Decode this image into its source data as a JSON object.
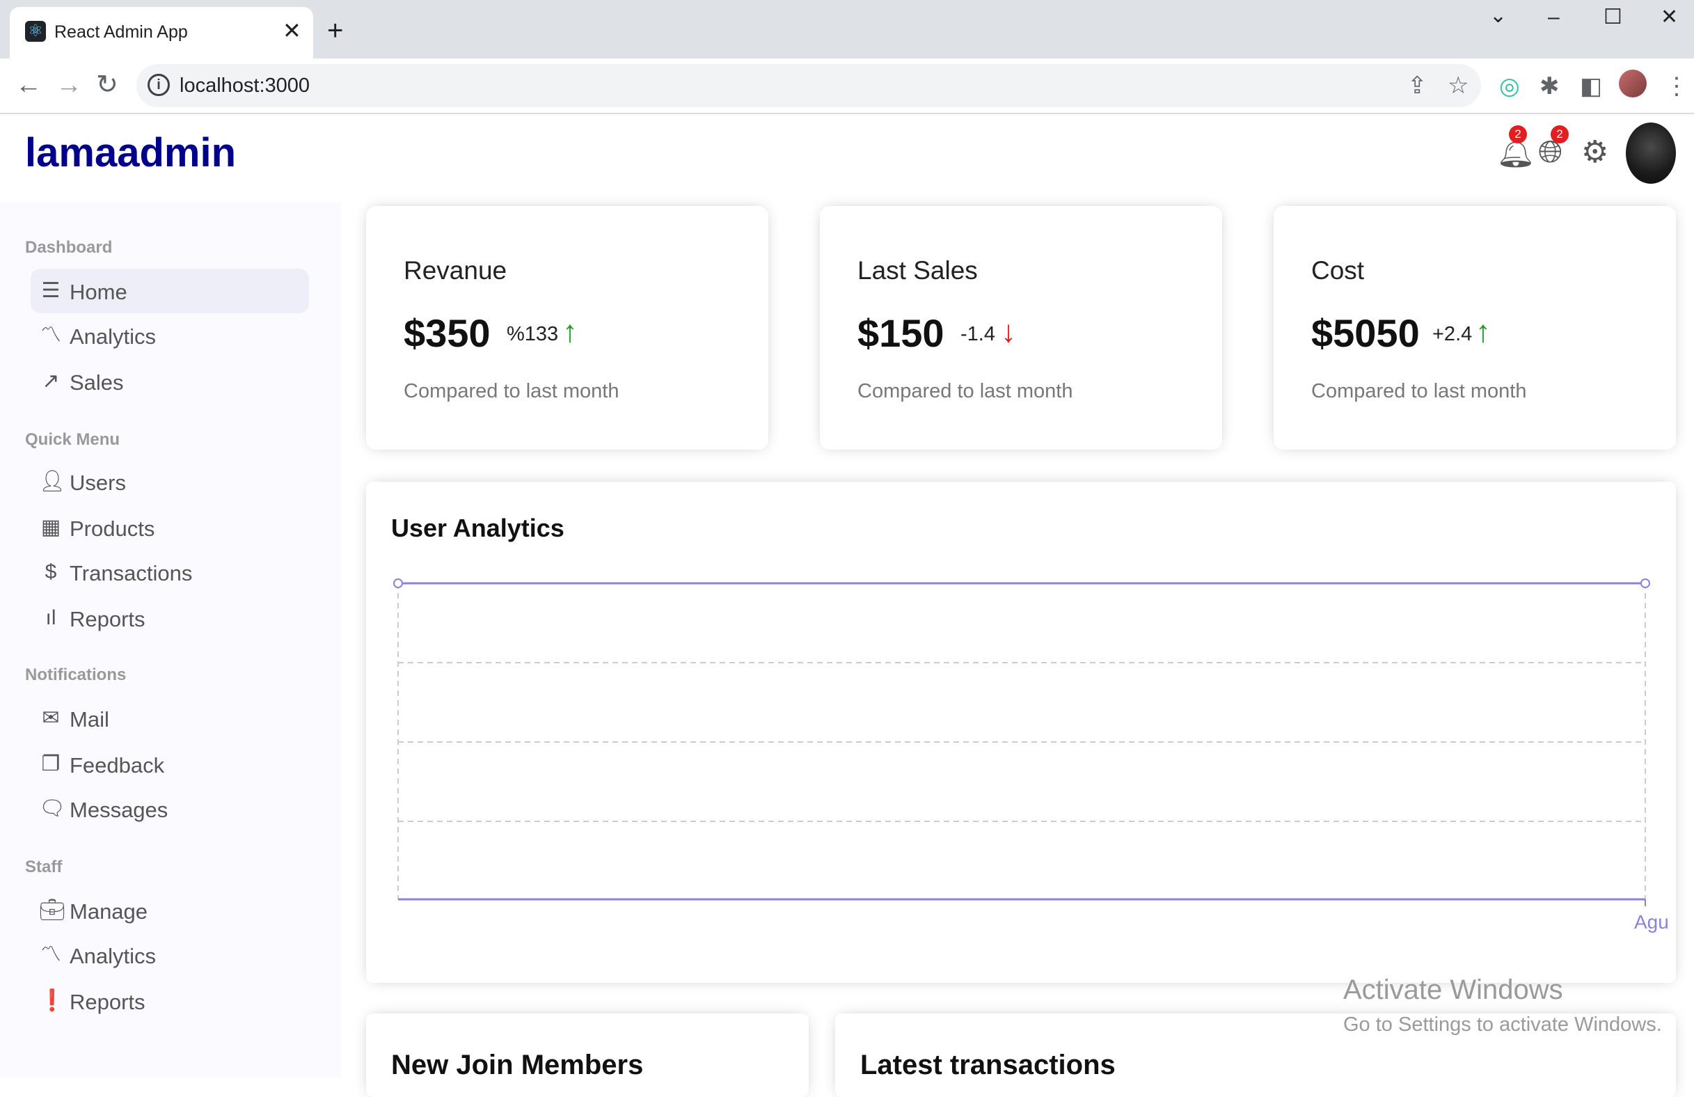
{
  "browser": {
    "tab_title": "React Admin App",
    "tab_close": "✕",
    "new_tab": "+",
    "url": "localhost:3000"
  },
  "app": {
    "logo": "lamaadmin",
    "notifications_count": "2",
    "language_count": "2"
  },
  "sidebar": {
    "sections": [
      {
        "title": "Dashboard",
        "items": [
          "Home",
          "Analytics",
          "Sales"
        ]
      },
      {
        "title": "Quick Menu",
        "items": [
          "Users",
          "Products",
          "Transactions",
          "Reports"
        ]
      },
      {
        "title": "Notifications",
        "items": [
          "Mail",
          "Feedback",
          "Messages"
        ]
      },
      {
        "title": "Staff",
        "items": [
          "Manage",
          "Analytics",
          "Reports"
        ]
      }
    ]
  },
  "cards": [
    {
      "title": "Revanue",
      "money": "$350",
      "rate": "%133",
      "trend": "up",
      "sub": "Compared to last month"
    },
    {
      "title": "Last Sales",
      "money": "$150",
      "rate": "-1.4",
      "trend": "down",
      "sub": "Compared to last month"
    },
    {
      "title": "Cost",
      "money": "$5050",
      "rate": "+2.4",
      "trend": "up",
      "sub": "Compared to last month"
    }
  ],
  "chart": {
    "title": "User Analytics",
    "x_label": "Agu"
  },
  "widgets": {
    "members_title": "New Join Members",
    "transactions_title": "Latest transactions"
  },
  "watermark": {
    "line1": "Activate Windows",
    "line2": "Go to Settings to activate Windows."
  },
  "colors": {
    "accent": "#8884d8",
    "logo": "#00008b",
    "up": "#1e9f1e",
    "down": "#e02020"
  }
}
